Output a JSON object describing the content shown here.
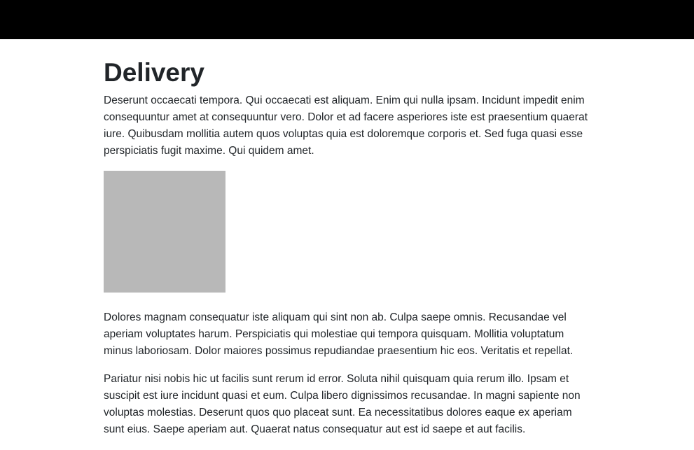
{
  "page": {
    "title": "Delivery",
    "paragraphs": [
      "Deserunt occaecati tempora. Qui occaecati est aliquam. Enim qui nulla ipsam. Incidunt impedit enim consequuntur amet at consequuntur vero. Dolor et ad facere asperiores iste est praesentium quaerat iure. Quibusdam mollitia autem quos voluptas quia est doloremque corporis et. Sed fuga quasi esse perspiciatis fugit maxime. Qui quidem amet.",
      "Dolores magnam consequatur iste aliquam qui sint non ab. Culpa saepe omnis. Recusandae vel aperiam voluptates harum. Perspiciatis qui molestiae qui tempora quisquam. Mollitia voluptatum minus laboriosam. Dolor maiores possimus repudiandae praesentium hic eos. Veritatis et repellat.",
      "Pariatur nisi nobis hic ut facilis sunt rerum id error. Soluta nihil quisquam quia rerum illo. Ipsam et suscipit est iure incidunt quasi et eum. Culpa libero dignissimos recusandae. In magni sapiente non voluptas molestias. Deserunt quos quo placeat sunt. Ea necessitatibus dolores eaque ex aperiam sunt eius. Saepe aperiam aut. Quaerat natus consequatur aut est id saepe et aut facilis."
    ]
  },
  "colors": {
    "topbar": "#000000",
    "placeholder": "#b8b8b8",
    "text": "#212529"
  }
}
